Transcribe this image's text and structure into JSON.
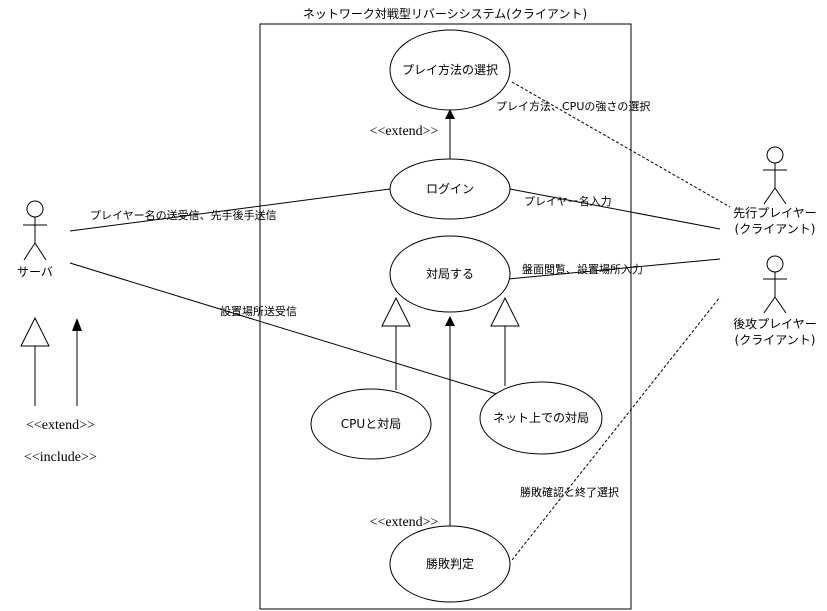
{
  "system": {
    "title": "ネットワーク対戦型リバーシシステム(クライアント)"
  },
  "actors": {
    "server": {
      "label": "サーバ"
    },
    "first_player": {
      "line1": "先行プレイヤー",
      "line2": "(クライアント)"
    },
    "second_player": {
      "line1": "後攻プレイヤー",
      "line2": "(クライアント)"
    }
  },
  "use_cases": {
    "play_method": "プレイ方法の選択",
    "login": "ログイン",
    "match": "対局する",
    "cpu_match": "CPUと対局",
    "net_match": "ネット上での対局",
    "result": "勝敗判定"
  },
  "relations": {
    "extend_top": "<<extend>>",
    "extend_bottom": "<<extend>>"
  },
  "edge_labels": {
    "play_method_select": "プレイ方法、CPUの強さの選択",
    "player_name_input": "プレイヤー名入力",
    "board_view": "盤面閲覧、設置場所入力",
    "server_name_exchange": "プレイヤー名の送受信、先手後手送信",
    "placement_exchange": "設置場所送受信",
    "result_confirm": "勝敗確認と終了選択"
  },
  "legend": {
    "extend": "<<extend>>",
    "include": "<<include>>"
  }
}
